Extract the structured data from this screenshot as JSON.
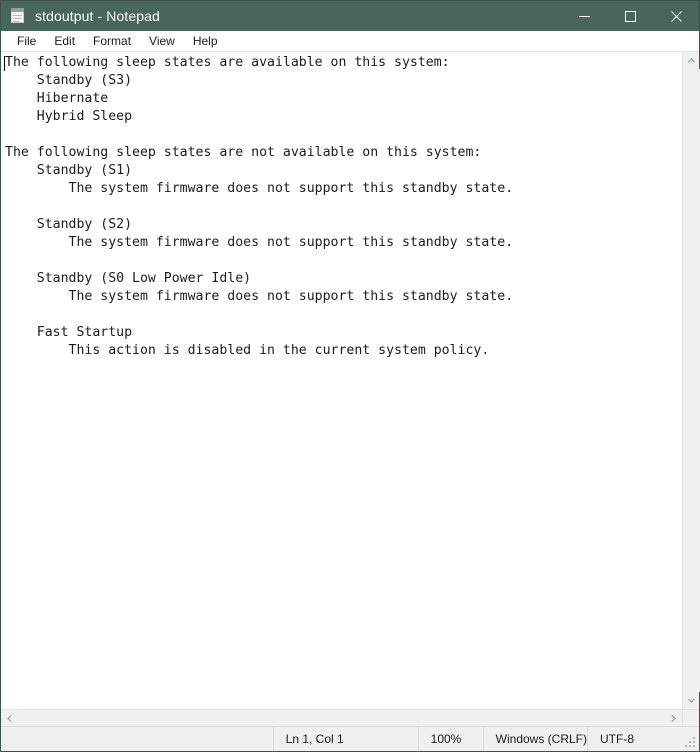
{
  "window": {
    "title": "stdoutput - Notepad",
    "icon": "notepad-icon",
    "controls": {
      "minimize": "Minimize",
      "maximize": "Maximize",
      "close": "Close"
    },
    "titlebar_color": "#48665c"
  },
  "menubar": {
    "items": [
      {
        "label": "File"
      },
      {
        "label": "Edit"
      },
      {
        "label": "Format"
      },
      {
        "label": "View"
      },
      {
        "label": "Help"
      }
    ]
  },
  "editor": {
    "text": "The following sleep states are available on this system:\n    Standby (S3)\n    Hibernate\n    Hybrid Sleep\n\nThe following sleep states are not available on this system:\n    Standby (S1)\n        The system firmware does not support this standby state.\n\n    Standby (S2)\n        The system firmware does not support this standby state.\n\n    Standby (S0 Low Power Idle)\n        The system firmware does not support this standby state.\n\n    Fast Startup\n        This action is disabled in the current system policy.",
    "caret_visible": true
  },
  "scrollbars": {
    "vertical": {
      "up_arrow": "▲",
      "down_arrow": "▼"
    },
    "horizontal": {
      "left_arrow": "◀",
      "right_arrow": "▶"
    }
  },
  "statusbar": {
    "position": "Ln 1, Col 1",
    "zoom": "100%",
    "line_ending": "Windows (CRLF)",
    "encoding": "UTF-8"
  }
}
